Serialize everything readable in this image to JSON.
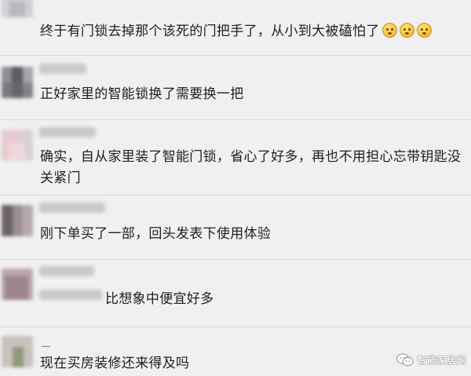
{
  "comments": [
    {
      "text": "终于有门锁去掉那个该死的门把手了，从小到大被磕怕了",
      "emoji": "flushed-face-emoji"
    },
    {
      "text": "正好家里的智能锁换了需要换一把"
    },
    {
      "text": "确实，自从家里装了智能门锁，省心了好多，再也不用担心忘带钥匙没关紧门"
    },
    {
      "text": "刚下单买了一部，回头发表下使用体验"
    },
    {
      "text": "比想象中便宜好多"
    },
    {
      "name": "__",
      "text": "现在买房装修还来得及吗"
    }
  ],
  "watermark": {
    "text": "智能家居网",
    "icon": "wechat-icon"
  }
}
